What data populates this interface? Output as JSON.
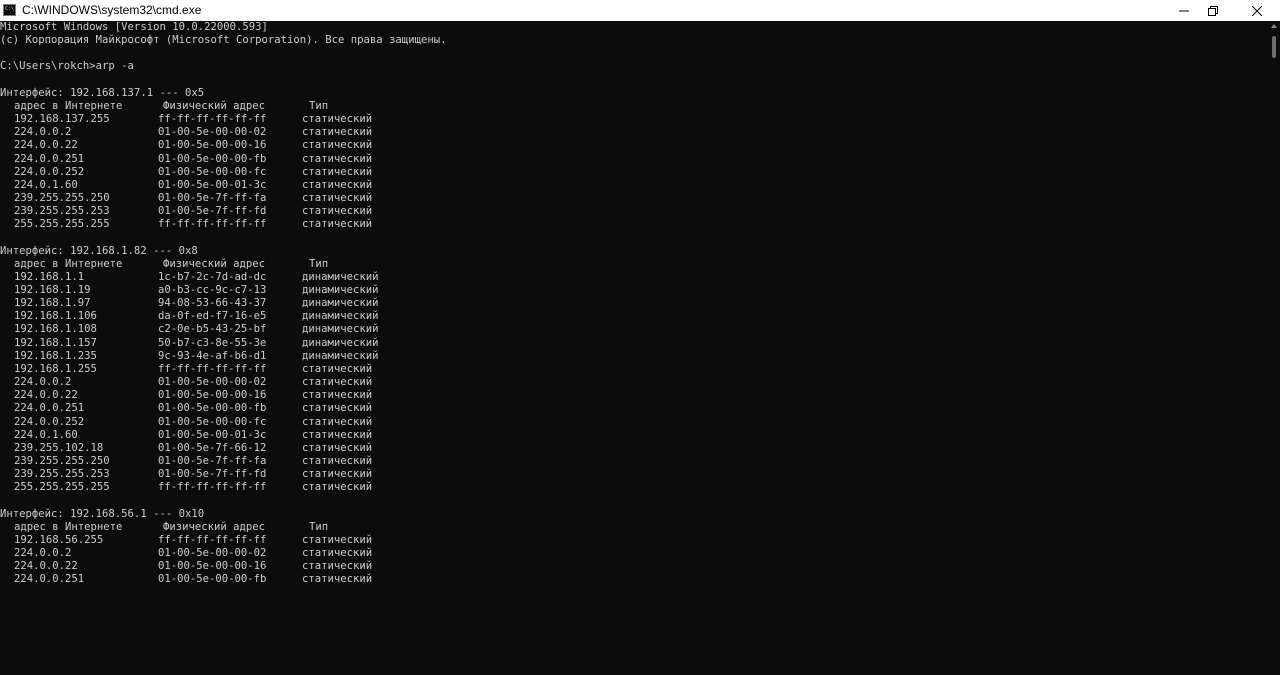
{
  "window": {
    "title": "C:\\WINDOWS\\system32\\cmd.exe",
    "icon": "cmd-icon"
  },
  "controls": {
    "minimize_icon": "minimize-icon",
    "maximize_icon": "restore-icon",
    "close_icon": "close-icon"
  },
  "console": {
    "header": [
      "Microsoft Windows [Version 10.0.22000.593]",
      "(c) Корпорация Майкрософт (Microsoft Corporation). Все права защищены."
    ],
    "prompt": "C:\\Users\\rokch>arp -a",
    "columns": {
      "address": "адрес в Интернете",
      "physical": "Физический адрес",
      "type": "Тип"
    },
    "interfaces": [
      {
        "title": "Интерфейс: 192.168.137.1 --- 0x5",
        "rows": [
          [
            "192.168.137.255",
            "ff-ff-ff-ff-ff-ff",
            "статический"
          ],
          [
            "224.0.0.2",
            "01-00-5e-00-00-02",
            "статический"
          ],
          [
            "224.0.0.22",
            "01-00-5e-00-00-16",
            "статический"
          ],
          [
            "224.0.0.251",
            "01-00-5e-00-00-fb",
            "статический"
          ],
          [
            "224.0.0.252",
            "01-00-5e-00-00-fc",
            "статический"
          ],
          [
            "224.0.1.60",
            "01-00-5e-00-01-3c",
            "статический"
          ],
          [
            "239.255.255.250",
            "01-00-5e-7f-ff-fa",
            "статический"
          ],
          [
            "239.255.255.253",
            "01-00-5e-7f-ff-fd",
            "статический"
          ],
          [
            "255.255.255.255",
            "ff-ff-ff-ff-ff-ff",
            "статический"
          ]
        ]
      },
      {
        "title": "Интерфейс: 192.168.1.82 --- 0x8",
        "rows": [
          [
            "192.168.1.1",
            "1c-b7-2c-7d-ad-dc",
            "динамический"
          ],
          [
            "192.168.1.19",
            "a0-b3-cc-9c-c7-13",
            "динамический"
          ],
          [
            "192.168.1.97",
            "94-08-53-66-43-37",
            "динамический"
          ],
          [
            "192.168.1.106",
            "da-0f-ed-f7-16-e5",
            "динамический"
          ],
          [
            "192.168.1.108",
            "c2-0e-b5-43-25-bf",
            "динамический"
          ],
          [
            "192.168.1.157",
            "50-b7-c3-8e-55-3e",
            "динамический"
          ],
          [
            "192.168.1.235",
            "9c-93-4e-af-b6-d1",
            "динамический"
          ],
          [
            "192.168.1.255",
            "ff-ff-ff-ff-ff-ff",
            "статический"
          ],
          [
            "224.0.0.2",
            "01-00-5e-00-00-02",
            "статический"
          ],
          [
            "224.0.0.22",
            "01-00-5e-00-00-16",
            "статический"
          ],
          [
            "224.0.0.251",
            "01-00-5e-00-00-fb",
            "статический"
          ],
          [
            "224.0.0.252",
            "01-00-5e-00-00-fc",
            "статический"
          ],
          [
            "224.0.1.60",
            "01-00-5e-00-01-3c",
            "статический"
          ],
          [
            "239.255.102.18",
            "01-00-5e-7f-66-12",
            "статический"
          ],
          [
            "239.255.255.250",
            "01-00-5e-7f-ff-fa",
            "статический"
          ],
          [
            "239.255.255.253",
            "01-00-5e-7f-ff-fd",
            "статический"
          ],
          [
            "255.255.255.255",
            "ff-ff-ff-ff-ff-ff",
            "статический"
          ]
        ]
      },
      {
        "title": "Интерфейс: 192.168.56.1 --- 0x10",
        "rows": [
          [
            "192.168.56.255",
            "ff-ff-ff-ff-ff-ff",
            "статический"
          ],
          [
            "224.0.0.2",
            "01-00-5e-00-00-02",
            "статический"
          ],
          [
            "224.0.0.22",
            "01-00-5e-00-00-16",
            "статический"
          ],
          [
            "224.0.0.251",
            "01-00-5e-00-00-fb",
            "статический"
          ]
        ]
      }
    ]
  },
  "colors": {
    "background": "#0c0c0c",
    "foreground": "#cccccc",
    "titlebar": "#ffffff"
  }
}
